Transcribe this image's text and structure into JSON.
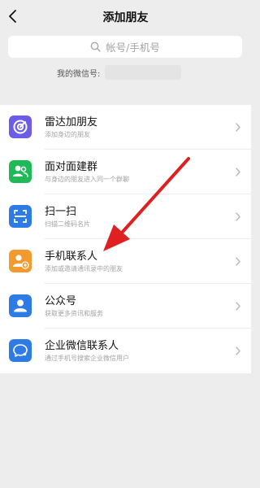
{
  "header": {
    "title": "添加朋友",
    "back_icon": "chevron-left-icon"
  },
  "search": {
    "placeholder": "帐号/手机号",
    "icon": "search-icon"
  },
  "my_id": {
    "label": "我的微信号:",
    "value": ""
  },
  "items": [
    {
      "title": "雷达加朋友",
      "subtitle": "添加身边的朋友",
      "icon": "radar-icon",
      "color": "#6b5de6"
    },
    {
      "title": "面对面建群",
      "subtitle": "与身边的朋友进入同一个群聊",
      "icon": "group-icon",
      "color": "#1fb957"
    },
    {
      "title": "扫一扫",
      "subtitle": "扫描二维码名片",
      "icon": "scan-icon",
      "color": "#2e7be6"
    },
    {
      "title": "手机联系人",
      "subtitle": "添加或邀请通讯录中的朋友",
      "icon": "add-contact-icon",
      "color": "#f29a2e"
    },
    {
      "title": "公众号",
      "subtitle": "获取更多资讯和服务",
      "icon": "official-account-icon",
      "color": "#2e7be6"
    },
    {
      "title": "企业微信联系人",
      "subtitle": "通过手机号搜索企业微信用户",
      "icon": "work-wechat-icon",
      "color": "#2e7be6"
    }
  ],
  "annotation": {
    "icon": "red-arrow-icon",
    "color": "#e02020"
  }
}
